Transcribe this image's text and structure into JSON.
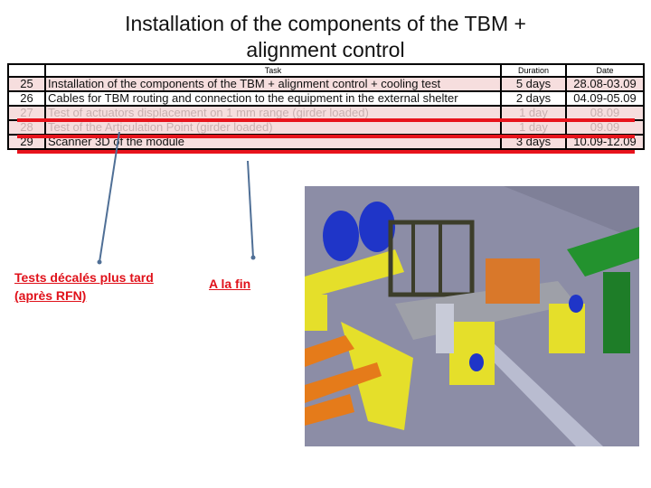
{
  "slide": {
    "title_line1": "Installation of the components of the TBM +",
    "title_line2": "alignment control"
  },
  "table": {
    "headers": {
      "num": "",
      "task": "Task",
      "duration": "Duration",
      "date": "Date"
    },
    "rows": [
      {
        "num": "25",
        "task": "Installation of the components of the TBM + alignment control + cooling test",
        "duration": "5 days",
        "date": "28.08-03.09",
        "struck": false
      },
      {
        "num": "26",
        "task": "Cables for TBM routing and connection to the equipment in the external shelter",
        "duration": "2 days",
        "date": "04.09-05.09",
        "struck": false
      },
      {
        "num": "27",
        "task": "Test of actuators displacement on 1 mm range (girder loaded)",
        "duration": "1 day",
        "date": "08.09",
        "struck": true
      },
      {
        "num": "28",
        "task": "Test of the Articulation Point (girder loaded)",
        "duration": "1 day",
        "date": "09.09",
        "struck": true
      },
      {
        "num": "29",
        "task": "Scanner 3D of the module",
        "duration": "3 days",
        "date": "10.09-12.09",
        "struck": true
      }
    ]
  },
  "annotations": {
    "postponed_line1": "Tests décalés plus tard",
    "postponed_line2": "(après RFN)",
    "at_end": "A la fin"
  },
  "colors": {
    "strike": "#e8131c",
    "note": "#e0111a",
    "arrow": "#4f6f96",
    "row_pink": "#f6dede"
  },
  "image": {
    "description": "3D CAD rendering of TBM module installation with magnets, girder and supports"
  }
}
